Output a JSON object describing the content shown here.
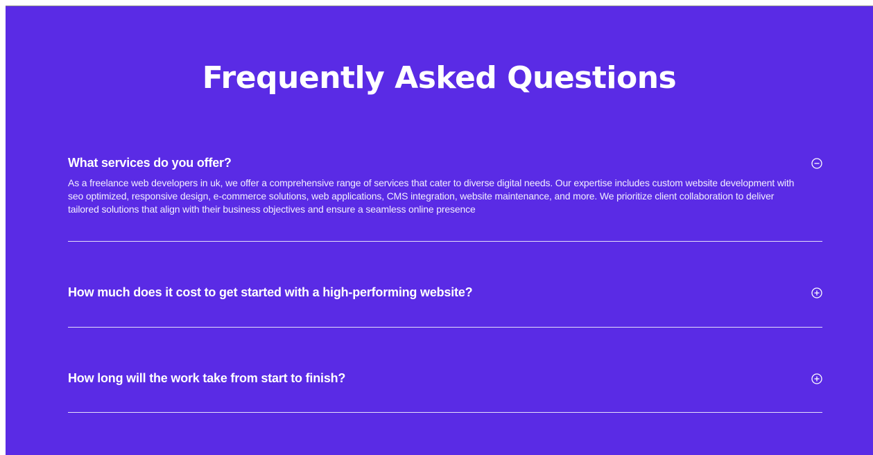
{
  "theme": {
    "background": "#5a2be5",
    "text": "#ffffff"
  },
  "faq": {
    "title": "Frequently Asked Questions",
    "items": [
      {
        "question": "What services do you offer?",
        "answer": "As a freelance web developers in uk, we offer a comprehensive range of services that cater to diverse digital needs. Our expertise includes custom website development with seo optimized, responsive design, e-commerce solutions, web applications, CMS integration, website maintenance, and more. We prioritize client collaboration to deliver tailored solutions that align with their business objectives and ensure a seamless online presence",
        "expanded": true,
        "icon": "minus-circle-icon"
      },
      {
        "question": "How much does it cost to get started with a high-performing website?",
        "expanded": false,
        "icon": "plus-circle-icon"
      },
      {
        "question": "How long will the work take from start to finish?",
        "expanded": false,
        "icon": "plus-circle-icon"
      }
    ]
  }
}
